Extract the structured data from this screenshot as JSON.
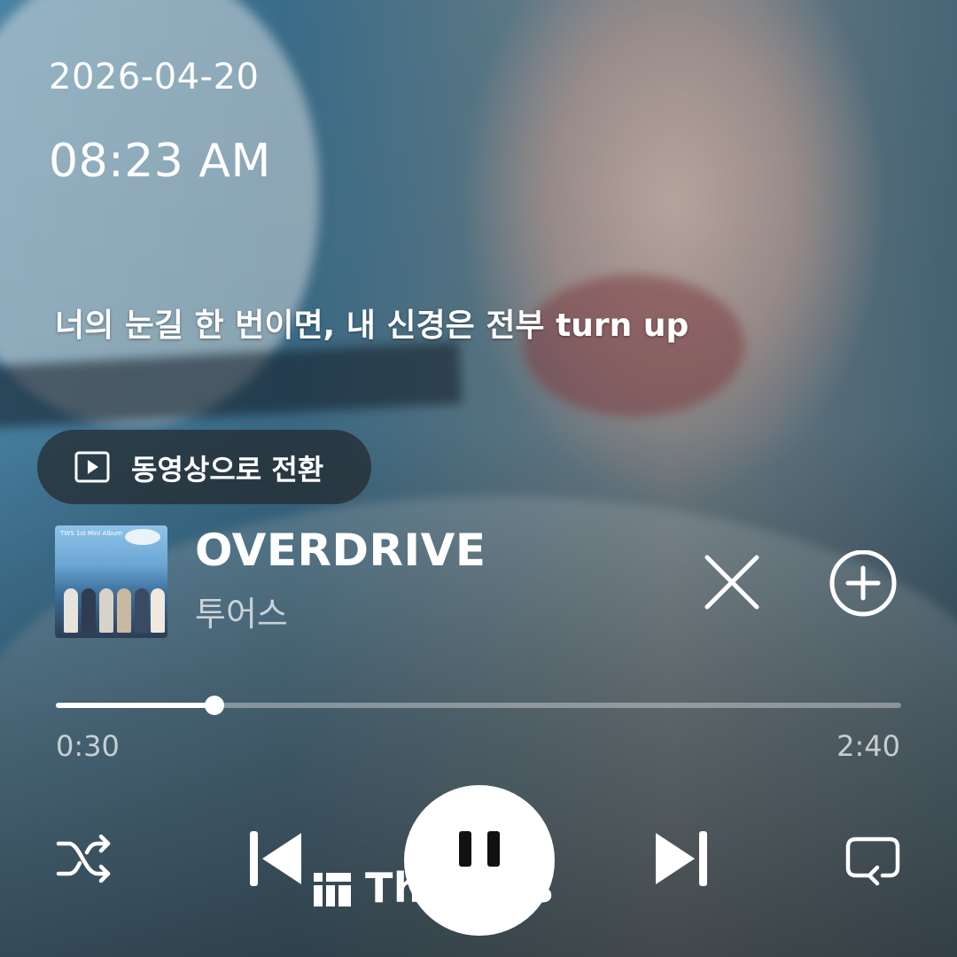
{
  "status": {
    "date": "2026-04-20",
    "time": "08:23 AM"
  },
  "lyrics": {
    "current_line": "너의 눈길 한 번이면, 내 신경은 전부 turn up"
  },
  "video_toggle": {
    "label": "동영상으로 전환",
    "icon": "play-square-icon"
  },
  "now_playing": {
    "title": "OVERDRIVE",
    "artist": "투어스",
    "album_art_text": "TWS 1st Mini Album",
    "album_art_icon": "album-art"
  },
  "progress": {
    "elapsed": "0:30",
    "total": "2:40",
    "fraction": 0.1875
  },
  "controls": {
    "shuffle_icon": "shuffle-icon",
    "prev_icon": "skip-previous-icon",
    "play_state": "playing",
    "pause_icon": "pause-icon",
    "next_icon": "skip-next-icon",
    "repeat_icon": "repeat-icon",
    "close_icon": "close-icon",
    "add_icon": "add-circle-icon"
  },
  "watermark": {
    "text": "Threads",
    "icon": "threads-logo-icon"
  },
  "colors": {
    "foreground": "#ffffff",
    "pill_bg": "#23282d",
    "progress_track": "#9aa3a8"
  }
}
